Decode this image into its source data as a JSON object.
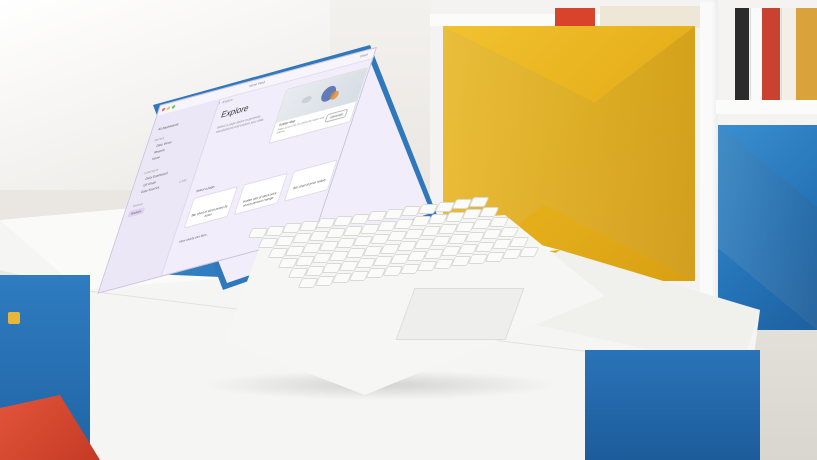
{
  "scene": {
    "description_colors": {
      "wall": "#ecE9e4",
      "yellow_box": "#e7b21d",
      "blue_box": "#2472b6",
      "laptop_stand": "#3d8fcf",
      "desk": "#f7f7f5",
      "screen_bg": "#f1edfa"
    }
  },
  "screen": {
    "window_title": "Home Feed",
    "breadcrumb": "Projects  ·  Daily Sales Dashboard  ·  Explore",
    "share_label": "Share",
    "sidebar": {
      "top_item": "All Dashboards",
      "section_recent": "Recent",
      "items_recent": [
        "Data Views",
        "Reports",
        "Home"
      ],
      "section_collections": "Collections",
      "items_collections": [
        "Daily Dashboard",
        "Q3 Goals",
        "Data Sources"
      ],
      "count_badge": "1,452",
      "section_shared": "Shared",
      "active_item": "Explore"
    },
    "main": {
      "title": "Explore",
      "subtitle": "Select a page above to generate visualizations and explore your data.",
      "map_card_title": "Scatter Map",
      "map_card_desc": "Sales across the US plotted by region and volume",
      "map_card_button": "Generate",
      "pages_label": "Select a page...",
      "cards": [
        "Bar chart of stock prices by ticker",
        "Scatter plot of stock price versus percent change",
        "Bar chart of price history"
      ],
      "more_label": "How charts can flow..."
    }
  }
}
